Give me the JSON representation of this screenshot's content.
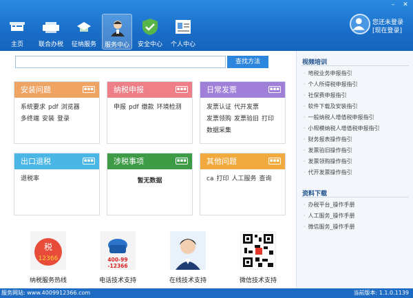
{
  "window": {
    "min": "–",
    "close": "✕"
  },
  "nav": [
    {
      "label": "主页",
      "icon": "home-icon"
    },
    {
      "label": "联合办税",
      "icon": "printer-icon"
    },
    {
      "label": "征纳服务",
      "icon": "arrow-icon"
    },
    {
      "label": "服务中心",
      "icon": "service-person-icon"
    },
    {
      "label": "安全中心",
      "icon": "shield-icon"
    },
    {
      "label": "个人中心",
      "icon": "profile-card-icon"
    }
  ],
  "user": {
    "status": "您还未登录",
    "login": "[现在登录]"
  },
  "search": {
    "value": "",
    "button": "查找方法"
  },
  "cards": [
    {
      "title": "安装问题",
      "color": "#f0a464",
      "links": [
        "系统要求",
        "pdf",
        "浏览器",
        "多终端",
        "安装",
        "登录"
      ]
    },
    {
      "title": "纳税申报",
      "color": "#ee7f87",
      "links": [
        "申报",
        "pdf",
        "缴款",
        "环境检测"
      ]
    },
    {
      "title": "日常发票",
      "color": "#a07fd8",
      "links": [
        "发票认证",
        "代开发票",
        "发票领购",
        "发票验旧",
        "打印",
        "数据采集"
      ]
    },
    {
      "title": "出口退税",
      "color": "#4ab6e6",
      "links": [
        "退税率"
      ]
    },
    {
      "title": "涉税事项",
      "color": "#3d9b46",
      "center": "暂无数据"
    },
    {
      "title": "其他问题",
      "color": "#f0aa3e",
      "links": [
        "ca",
        "打印",
        "人工服务",
        "查询"
      ]
    }
  ],
  "more_label": "▪▪▪",
  "supports": [
    {
      "label": "纳税服务热线",
      "image_text": "税 12366"
    },
    {
      "label": "电话技术支持",
      "image_text": "400-99 -12366"
    },
    {
      "label": "在线技术支持",
      "image_text": ""
    },
    {
      "label": "微信技术支持",
      "image_text": ""
    }
  ],
  "video_title": "视频培训",
  "video_items": [
    "地税业务申报指引",
    "个人所得税申报指引",
    "社保费申报指引",
    "软件下载及安装指引",
    "一般纳税人增值税申报指引",
    "小规模纳税人增值税申报指引",
    "财务报表操作指引",
    "发票验旧操作指引",
    "发票领购操作指引",
    "代开发票操作指引"
  ],
  "download_title": "资料下载",
  "download_items": [
    "办税平台_操作手册",
    "人工服务_操作手册",
    "微信服务_操作手册"
  ],
  "status": {
    "site": "服务网站: www.4009912366.com",
    "version": "当前版本: 1.1.0.1139"
  },
  "colors": {
    "topbar": "#1a6ec9",
    "accent": "#2d86de"
  }
}
